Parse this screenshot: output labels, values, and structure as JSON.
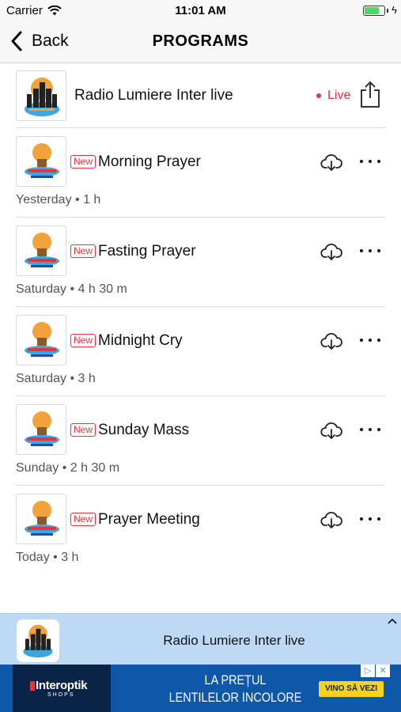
{
  "status_bar": {
    "carrier": "Carrier",
    "time": "11:01 AM"
  },
  "nav": {
    "back_label": "Back",
    "title": "PROGRAMS"
  },
  "live": {
    "title": "Radio Lumiere Inter live",
    "badge": "Live"
  },
  "episodes": [
    {
      "badge": "New",
      "title": "Morning Prayer",
      "meta": "Yesterday • 1 h"
    },
    {
      "badge": "New",
      "title": "Fasting Prayer",
      "meta": "Saturday • 4 h 30 m"
    },
    {
      "badge": "New",
      "title": "Midnight Cry",
      "meta": "Saturday • 3 h"
    },
    {
      "badge": "New",
      "title": "Sunday Mass",
      "meta": "Sunday • 2 h 30 m"
    },
    {
      "badge": "New",
      "title": "Prayer Meeting",
      "meta": "Today • 3 h"
    }
  ],
  "mini_player": {
    "title": "Radio Lumiere Inter live"
  },
  "ad": {
    "brand": "Interoptik",
    "brand_sub": "SHOPS",
    "line1": "LA PREȚUL",
    "line2": "LENTILELOR INCOLORE",
    "cta": "VINO SĂ VEZI"
  },
  "colors": {
    "accent_red": "#e8323c",
    "mini_player_bg": "#bed9f3",
    "ad_bg": "#0f57a8",
    "ad_cta": "#f4d21f"
  },
  "icons": [
    "wifi-icon",
    "battery-icon",
    "back-chevron-icon",
    "share-icon",
    "download-icon",
    "more-icon",
    "chevron-up-icon",
    "podcast-logo-icon"
  ]
}
